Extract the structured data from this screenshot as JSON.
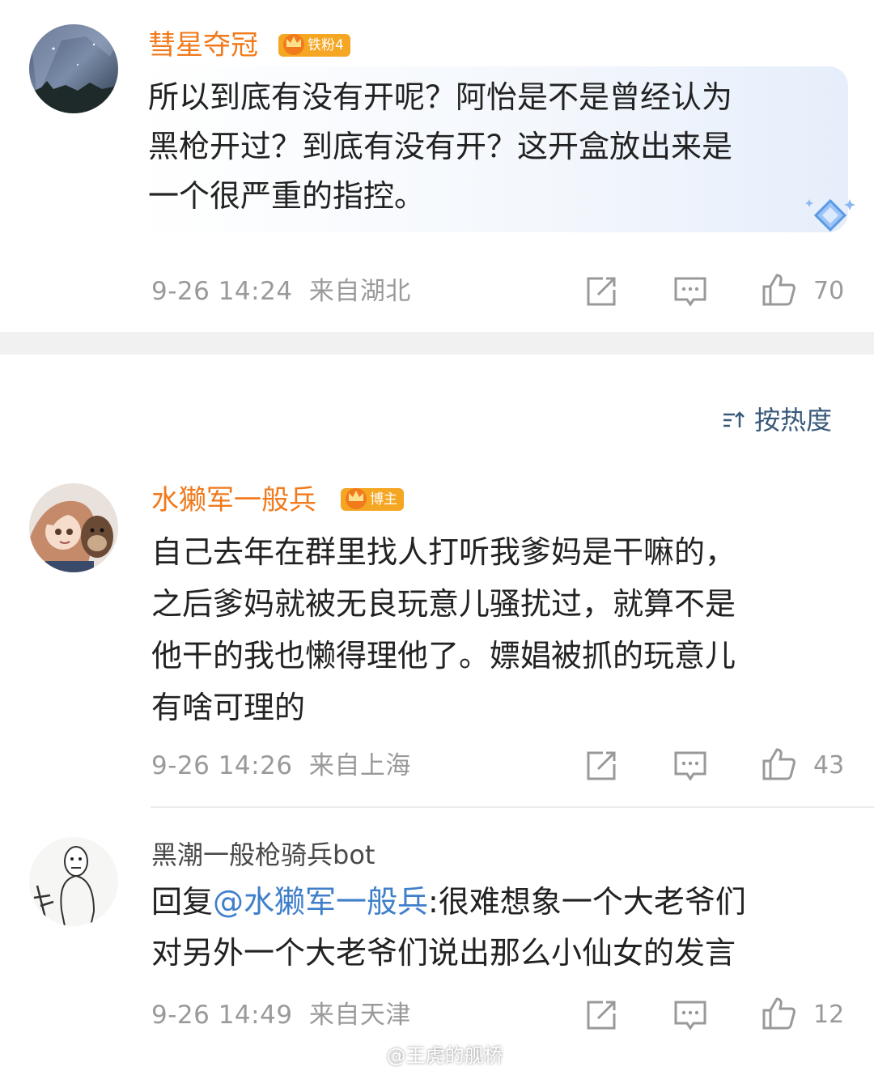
{
  "comments": [
    {
      "username": "彗星夺冠",
      "badge": "铁粉4",
      "text_lines": [
        "所以到底有没有开呢？阿怡是不是曾经认为",
        "黑枪开过？到底有没有开？这开盒放出来是",
        "一个很严重的指控。"
      ],
      "date": "9-26 14:24",
      "location": "来自湖北",
      "likes": "70"
    },
    {
      "username": "水獭军一般兵",
      "badge": "博主",
      "text_lines": [
        "自己去年在群里找人打听我爹妈是干嘛的，",
        "之后爹妈就被无良玩意儿骚扰过，就算不是",
        "他干的我也懒得理他了。嫖娼被抓的玩意儿",
        "有啥可理的"
      ],
      "date": "9-26 14:26",
      "location": "来自上海",
      "likes": "43"
    },
    {
      "username": "黑潮一般枪骑兵bot",
      "reply_prefix": "回复",
      "reply_mention": "@水獭军一般兵",
      "reply_sep": ":",
      "text_first": "很难想象一个大老爷们",
      "text_line2": "对另外一个大老爷们说出那么小仙女的发言",
      "date": "9-26 14:49",
      "location": "来自天津",
      "likes": "12"
    }
  ],
  "sort_label": "按热度",
  "watermark": "@王虎的舰桥",
  "icons": [
    "share-icon",
    "comment-icon",
    "like-icon",
    "sort-icon",
    "crown-icon",
    "weibo-logo-icon"
  ],
  "colors": {
    "username_highlight": "#f07a1c",
    "mention": "#3f7fca",
    "badge": "#f5a623"
  }
}
